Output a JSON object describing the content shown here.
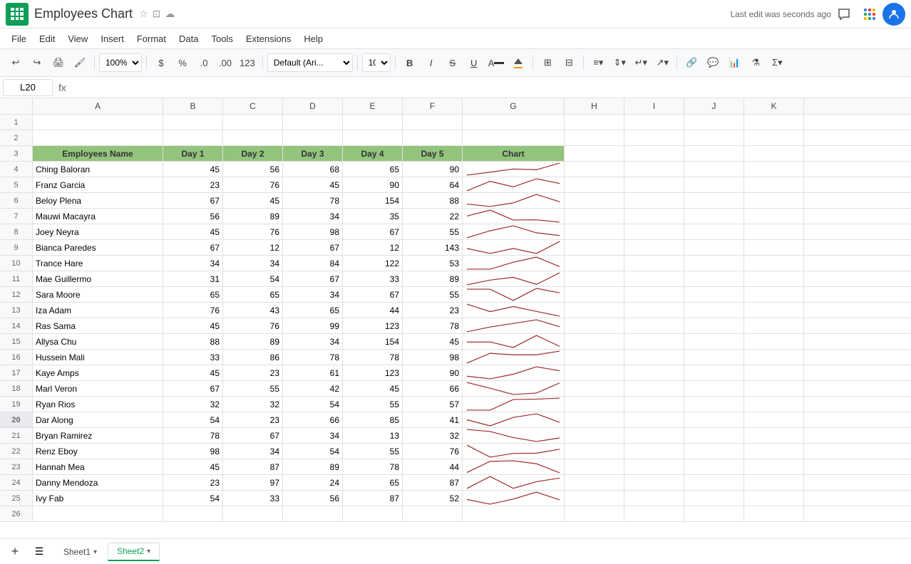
{
  "app": {
    "icon_label": "Google Sheets",
    "title": "Employees Chart",
    "last_edit": "Last edit was seconds ago"
  },
  "menu": {
    "items": [
      "File",
      "Edit",
      "View",
      "Insert",
      "Format",
      "Data",
      "Tools",
      "Extensions",
      "Help"
    ]
  },
  "toolbar": {
    "zoom": "100%",
    "currency": "$",
    "percent": "%",
    "decimal_less": ".0",
    "decimal_more": ".00",
    "format_type": "123",
    "font": "Default (Ari...",
    "font_size": "10",
    "bold": "B",
    "italic": "I",
    "strike": "S",
    "underline": "U"
  },
  "formula_bar": {
    "cell_ref": "L20",
    "fx_label": "fx"
  },
  "columns": {
    "headers": [
      "",
      "A",
      "B",
      "C",
      "D",
      "E",
      "F",
      "G",
      "H",
      "I",
      "J",
      "K"
    ]
  },
  "header_row": {
    "row_num": "3",
    "cells": [
      "Employees Name",
      "Day 1",
      "Day 2",
      "Day 3",
      "Day 4",
      "Day 5",
      "Chart",
      "",
      "",
      "",
      "",
      ""
    ]
  },
  "rows": [
    {
      "num": "1",
      "cells": [
        "",
        "",
        "",
        "",
        "",
        "",
        "",
        "",
        "",
        "",
        "",
        ""
      ]
    },
    {
      "num": "2",
      "cells": [
        "",
        "",
        "",
        "",
        "",
        "",
        "",
        "",
        "",
        "",
        "",
        ""
      ]
    },
    {
      "num": "4",
      "name": "Ching Baloran",
      "d1": 45,
      "d2": 56,
      "d3": 68,
      "d4": 65,
      "d5": 90,
      "data": [
        45,
        56,
        68,
        65,
        90
      ]
    },
    {
      "num": "5",
      "name": "Franz Garcia",
      "d1": 23,
      "d2": 76,
      "d3": 45,
      "d4": 90,
      "d5": 64,
      "data": [
        23,
        76,
        45,
        90,
        64
      ]
    },
    {
      "num": "6",
      "name": "Beloy Plena",
      "d1": 67,
      "d2": 45,
      "d3": 78,
      "d4": 154,
      "d5": 88,
      "data": [
        67,
        45,
        78,
        154,
        88
      ]
    },
    {
      "num": "7",
      "name": "Mauwi Macayra",
      "d1": 56,
      "d2": 89,
      "d3": 34,
      "d4": 35,
      "d5": 22,
      "data": [
        56,
        89,
        34,
        35,
        22
      ]
    },
    {
      "num": "8",
      "name": "Joey Neyra",
      "d1": 45,
      "d2": 76,
      "d3": 98,
      "d4": 67,
      "d5": 55,
      "data": [
        45,
        76,
        98,
        67,
        55
      ]
    },
    {
      "num": "9",
      "name": "Bianca Paredes",
      "d1": 67,
      "d2": 12,
      "d3": 67,
      "d4": 12,
      "d5": 143,
      "data": [
        67,
        12,
        67,
        12,
        143
      ]
    },
    {
      "num": "10",
      "name": "Trance Hare",
      "d1": 34,
      "d2": 34,
      "d3": 84,
      "d4": 122,
      "d5": 53,
      "data": [
        34,
        34,
        84,
        122,
        53
      ]
    },
    {
      "num": "11",
      "name": "Mae Guillermo",
      "d1": 31,
      "d2": 54,
      "d3": 67,
      "d4": 33,
      "d5": 89,
      "data": [
        31,
        54,
        67,
        33,
        89
      ]
    },
    {
      "num": "12",
      "name": "Sara Moore",
      "d1": 65,
      "d2": 65,
      "d3": 34,
      "d4": 67,
      "d5": 55,
      "data": [
        65,
        65,
        34,
        67,
        55
      ]
    },
    {
      "num": "13",
      "name": "Iza Adam",
      "d1": 76,
      "d2": 43,
      "d3": 65,
      "d4": 44,
      "d5": 23,
      "data": [
        76,
        43,
        65,
        44,
        23
      ]
    },
    {
      "num": "14",
      "name": "Ras Sama",
      "d1": 45,
      "d2": 76,
      "d3": 99,
      "d4": 123,
      "d5": 78,
      "data": [
        45,
        76,
        99,
        123,
        78
      ]
    },
    {
      "num": "15",
      "name": "Allysa Chu",
      "d1": 88,
      "d2": 89,
      "d3": 34,
      "d4": 154,
      "d5": 45,
      "data": [
        88,
        89,
        34,
        154,
        45
      ]
    },
    {
      "num": "16",
      "name": "Hussein Mali",
      "d1": 33,
      "d2": 86,
      "d3": 78,
      "d4": 78,
      "d5": 98,
      "data": [
        33,
        86,
        78,
        78,
        98
      ]
    },
    {
      "num": "17",
      "name": "Kaye Amps",
      "d1": 45,
      "d2": 23,
      "d3": 61,
      "d4": 123,
      "d5": 90,
      "data": [
        45,
        23,
        61,
        123,
        90
      ]
    },
    {
      "num": "18",
      "name": "Marl Veron",
      "d1": 67,
      "d2": 55,
      "d3": 42,
      "d4": 45,
      "d5": 66,
      "data": [
        67,
        55,
        42,
        45,
        66
      ]
    },
    {
      "num": "19",
      "name": "Ryan Rios",
      "d1": 32,
      "d2": 32,
      "d3": 54,
      "d4": 55,
      "d5": 57,
      "data": [
        32,
        32,
        54,
        55,
        57
      ]
    },
    {
      "num": "20",
      "name": "Dar Along",
      "d1": 54,
      "d2": 23,
      "d3": 66,
      "d4": 85,
      "d5": 41,
      "data": [
        54,
        23,
        66,
        85,
        41
      ]
    },
    {
      "num": "21",
      "name": "Bryan Ramirez",
      "d1": 78,
      "d2": 67,
      "d3": 34,
      "d4": 13,
      "d5": 32,
      "data": [
        78,
        67,
        34,
        13,
        32
      ]
    },
    {
      "num": "22",
      "name": "Renz Eboy",
      "d1": 98,
      "d2": 34,
      "d3": 54,
      "d4": 55,
      "d5": 76,
      "data": [
        98,
        34,
        54,
        55,
        76
      ]
    },
    {
      "num": "23",
      "name": "Hannah Mea",
      "d1": 45,
      "d2": 87,
      "d3": 89,
      "d4": 78,
      "d5": 44,
      "data": [
        45,
        87,
        89,
        78,
        44
      ]
    },
    {
      "num": "24",
      "name": "Danny Mendoza",
      "d1": 23,
      "d2": 97,
      "d3": 24,
      "d4": 65,
      "d5": 87,
      "data": [
        23,
        97,
        24,
        65,
        87
      ]
    },
    {
      "num": "25",
      "name": "Ivy Fab",
      "d1": 54,
      "d2": 33,
      "d3": 56,
      "d4": 87,
      "d5": 52,
      "data": [
        54,
        33,
        56,
        87,
        52
      ]
    },
    {
      "num": "26",
      "cells": [
        "",
        "",
        "",
        "",
        "",
        "",
        "",
        "",
        "",
        "",
        "",
        ""
      ]
    }
  ],
  "sheets": [
    {
      "name": "Sheet1",
      "active": false
    },
    {
      "name": "Sheet2",
      "active": true
    }
  ],
  "colors": {
    "header_bg": "#93c47d",
    "chart_line": "#a52a2a",
    "selected_row_bg": "#e8eaed"
  }
}
